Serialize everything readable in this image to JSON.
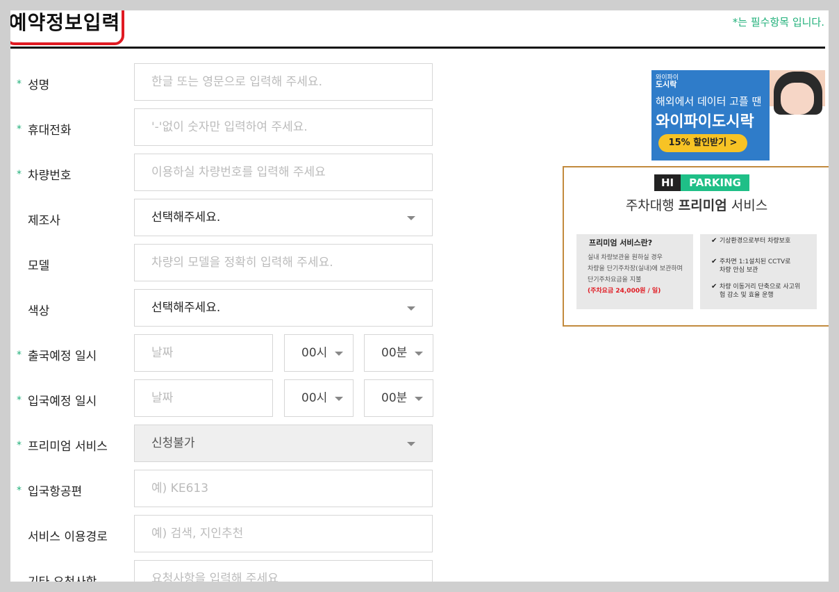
{
  "header": {
    "title": "예약정보입력",
    "required_note": "*는 필수항목 입니다."
  },
  "form": {
    "rows": [
      {
        "label": "성명",
        "required": true,
        "type": "text",
        "placeholder": "한글 또는 영문으로 입력해 주세요."
      },
      {
        "label": "휴대전화",
        "required": true,
        "type": "text",
        "placeholder": "'-'없이 숫자만 입력하여 주세요."
      },
      {
        "label": "차량번호",
        "required": true,
        "type": "text",
        "placeholder": "이용하실 차량번호를 입력해 주세요"
      },
      {
        "label": "제조사",
        "required": false,
        "type": "select",
        "value": "선택해주세요."
      },
      {
        "label": "모델",
        "required": false,
        "type": "text",
        "placeholder": "차량의 모델을 정확히 입력해 주세요."
      },
      {
        "label": "색상",
        "required": false,
        "type": "select",
        "value": "선택해주세요."
      },
      {
        "label": "출국예정 일시",
        "required": true,
        "type": "datetime",
        "date_placeholder": "날짜",
        "hour": "00시",
        "minute": "00분"
      },
      {
        "label": "입국예정 일시",
        "required": true,
        "type": "datetime",
        "date_placeholder": "날짜",
        "hour": "00시",
        "minute": "00분"
      },
      {
        "label": "프리미엄 서비스",
        "required": true,
        "type": "select-disabled",
        "value": "신청불가"
      },
      {
        "label": "입국항공편",
        "required": true,
        "type": "text",
        "placeholder": "예) KE613"
      },
      {
        "label": "서비스 이용경로",
        "required": false,
        "type": "text",
        "placeholder": "예) 검색, 지인추천"
      },
      {
        "label": "기타 요청사항",
        "required": false,
        "type": "text",
        "placeholder": "요청사항을 입력해 주세요"
      }
    ]
  },
  "ads": {
    "wifi": {
      "brand_small": "와이파이",
      "brand": "도시락",
      "tagline": "해외에서 데이터 고플 땐",
      "headline": "와이파이도시락",
      "button": "15% 할인받기 >"
    },
    "parking": {
      "badge_left": "HI",
      "badge_right": "PARKING",
      "subtitle_pre": "주차대행 ",
      "subtitle_bold": "프리미엄",
      "subtitle_post": " 서비스",
      "left_title": "프리미엄 서비스란?",
      "left_lines": [
        "실내 차량보관을 원하실 경우",
        "차량을 단기주차장(실내)에 보관하며",
        "단기주차요금을 지불"
      ],
      "left_price": "(주차요금 24,000원 / 일)",
      "right_items": [
        "기상환경으로부터 차량보호",
        "주차면 1:1설치된 CCTV로 차량 안심 보관",
        "차량 이동거리 단축으로 사고위험 감소 및 효율 운행"
      ]
    }
  },
  "colors": {
    "accent_green": "#21b07a",
    "title_outline": "#e01a22"
  }
}
